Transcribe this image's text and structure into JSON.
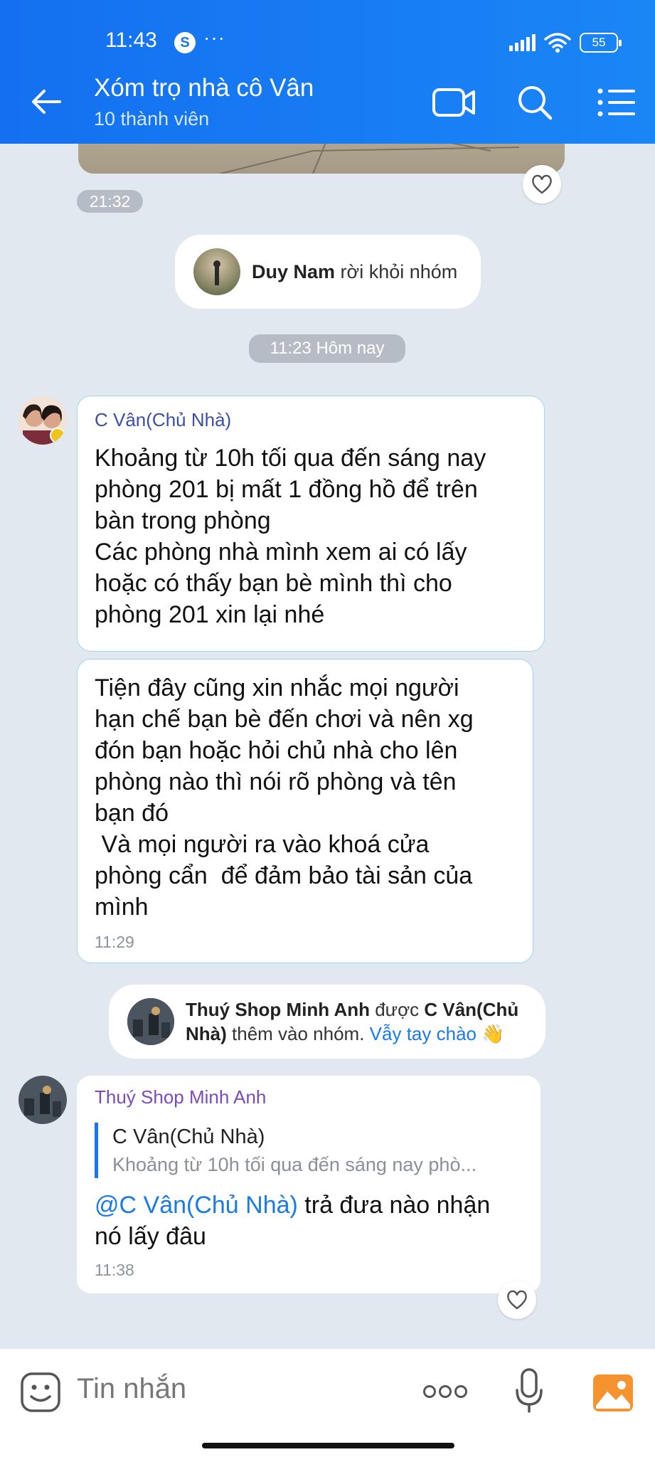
{
  "status_bar": {
    "time": "11:43",
    "app_badge": "S",
    "more": "···",
    "battery": "55"
  },
  "header": {
    "title": "Xóm trọ nhà cô Vân",
    "subtitle": "10 thành viên"
  },
  "chat": {
    "time_1": "21:32",
    "notice_leave": {
      "name": "Duy Nam",
      "text": " rời khỏi nhóm"
    },
    "date_divider": "11:23 Hôm nay",
    "message_1": {
      "sender": "C Vân(Chủ Nhà)",
      "text": "Khoảng từ 10h tối qua đến sáng nay\nphòng 201 bị mất 1 đồng hồ để trên\nbàn trong phòng\nCác phòng nhà mình xem ai có lấy\nhoặc có thấy bạn bè mình thì cho\nphòng 201 xin lại nhé"
    },
    "message_2": {
      "text": "Tiện đây cũng xin nhắc mọi người\nhạn chế bạn bè đến chơi và nên xg\nđón bạn hoặc hỏi chủ nhà cho lên\nphòng nào thì nói rõ phòng và tên\nbạn đó\n Và mọi người ra vào khoá cửa\nphòng cẩn  để đảm bảo tài sản của\nmình",
      "time": "11:29"
    },
    "notice_add": {
      "member": "Thuý Shop Minh Anh",
      "verb": " được ",
      "adder": "C Vân(Chủ\nNhà)",
      "text": " thêm vào nhóm. ",
      "wave": "Vẫy tay chào",
      "emoji": "👋"
    },
    "message_3": {
      "sender": "Thuý Shop Minh Anh",
      "reply_name": "C Vân(Chủ Nhà)",
      "reply_text": "Khoảng từ 10h tối qua đến sáng nay phò...",
      "mention": "@C Vân(Chủ Nhà)",
      "text_line1": " trả đưa nào nhận",
      "text_line2": "nó lấy đâu",
      "time": "11:38"
    }
  },
  "composer": {
    "placeholder": "Tin nhắn",
    "more": "ooo"
  },
  "colors": {
    "header": "#1677f0",
    "background": "#e2e8f0",
    "sender_1": "#3b4fa8",
    "sender_3": "#7b4bbd",
    "mention": "#1a7be8",
    "bubble_border": "#9ed6ef"
  }
}
